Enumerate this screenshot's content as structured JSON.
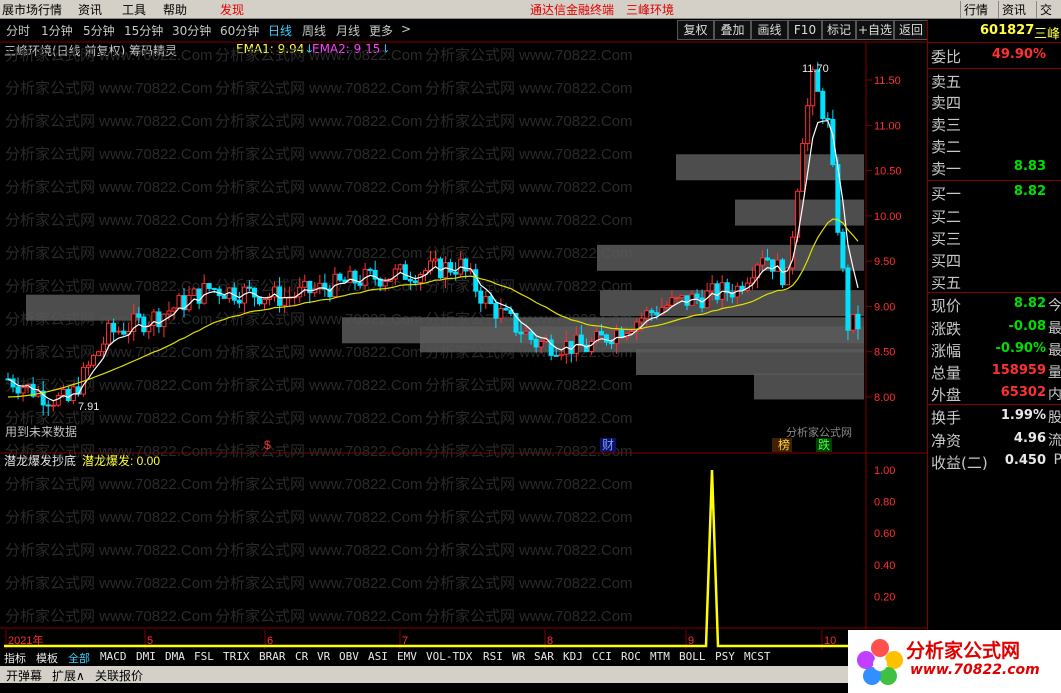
{
  "menu": {
    "items": [
      "展市场行情",
      "资讯",
      "工具",
      "帮助"
    ],
    "discover": "发现",
    "center_title": "通达信金融终端",
    "center_stock": "三峰环境",
    "right_items": [
      "行情",
      "资讯",
      "交"
    ]
  },
  "periods": [
    "分时",
    "1分钟",
    "5分钟",
    "15分钟",
    "30分钟",
    "60分钟",
    "日线",
    "周线",
    "月线",
    "更多",
    ">"
  ],
  "active_period": "日线",
  "tools": [
    "复权",
    "叠加",
    "画线",
    "F10",
    "标记",
    "+自选",
    "返回"
  ],
  "chart_title": "三峰环境(日线 前复权) 筹码精灵",
  "ema1_text": "EMA1: 9.94",
  "ema2_text": "EMA2: 9.15",
  "watermark": "分析家公式网 www.70822.Com",
  "watermark_small": "分析家公式网",
  "future_label": "用到未来数据",
  "price_high_label": "11.70",
  "price_low_label": "7.91",
  "markers": {
    "dollar": "$",
    "cai": "财",
    "rank": "榜",
    "die": "跌"
  },
  "indicator_title": "潜龙爆发抄底",
  "indicator_value": "潜龙爆发: 0.00",
  "price_axis": [
    "11.50",
    "11.00",
    "10.50",
    "10.00",
    "9.50",
    "9.00",
    "8.50",
    "8.00"
  ],
  "ind_axis": [
    "1.00",
    "0.80",
    "0.60",
    "0.40",
    "0.20"
  ],
  "date_axis": [
    {
      "label": "2021年",
      "color": "#ff3030"
    },
    {
      "label": "5",
      "color": "#ff3030"
    },
    {
      "label": "6",
      "color": "#ff3030"
    },
    {
      "label": "7",
      "color": "#ff3030"
    },
    {
      "label": "8",
      "color": "#ff3030"
    },
    {
      "label": "9",
      "color": "#ff3030"
    },
    {
      "label": "10",
      "color": "#ff3030"
    }
  ],
  "panel": {
    "code": "601827",
    "name": "三峰",
    "rows": [
      {
        "label": "委比",
        "value": "49.90%",
        "color": "red",
        "suffix": ""
      },
      {
        "label": "卖五",
        "value": "",
        "color": "white",
        "suffix": ""
      },
      {
        "label": "卖四",
        "value": "",
        "color": "white",
        "suffix": ""
      },
      {
        "label": "卖三",
        "value": "",
        "color": "white",
        "suffix": ""
      },
      {
        "label": "卖二",
        "value": "",
        "color": "white",
        "suffix": ""
      },
      {
        "label": "卖一",
        "value": "8.83",
        "color": "green",
        "suffix": ""
      },
      {
        "label": "买一",
        "value": "8.82",
        "color": "green",
        "suffix": ""
      },
      {
        "label": "买二",
        "value": "",
        "color": "white",
        "suffix": ""
      },
      {
        "label": "买三",
        "value": "",
        "color": "white",
        "suffix": ""
      },
      {
        "label": "买四",
        "value": "",
        "color": "white",
        "suffix": ""
      },
      {
        "label": "买五",
        "value": "",
        "color": "white",
        "suffix": ""
      },
      {
        "label": "现价",
        "value": "8.82",
        "color": "green",
        "suffix": "今"
      },
      {
        "label": "涨跌",
        "value": "-0.08",
        "color": "green",
        "suffix": "最"
      },
      {
        "label": "涨幅",
        "value": "-0.90%",
        "color": "green",
        "suffix": "最"
      },
      {
        "label": "总量",
        "value": "158959",
        "color": "red",
        "suffix": "量"
      },
      {
        "label": "外盘",
        "value": "65302",
        "color": "red",
        "suffix": "内"
      },
      {
        "label": "换手",
        "value": "1.99%",
        "color": "white",
        "suffix": "股"
      },
      {
        "label": "净资",
        "value": "4.96",
        "color": "white",
        "suffix": "流"
      },
      {
        "label": "收益(二)",
        "value": "0.450",
        "color": "white",
        "suffix": "P"
      }
    ]
  },
  "bottom_tabs": [
    "指标",
    "模板",
    "全部",
    "MACD",
    "DMI",
    "DMA",
    "FSL",
    "TRIX",
    "BRAR",
    "CR",
    "VR",
    "OBV",
    "ASI",
    "EMV",
    "VOL-TDX",
    "RSI",
    "WR",
    "SAR",
    "KDJ",
    "CCI",
    "ROC",
    "MTM",
    "BOLL",
    "PSY",
    "MCST"
  ],
  "bottom_selected": "全部",
  "status": [
    "开弹幕",
    "扩展∧",
    "关联报价"
  ],
  "logo": {
    "title": "分析家公式网",
    "url": "www.70822.com"
  },
  "colors": {
    "up": "#ff3030",
    "down": "#00e0ff",
    "ema1": "#ffffff",
    "ema2": "#e0e000",
    "indicator": "#ffff00",
    "grid": "#800000"
  }
}
